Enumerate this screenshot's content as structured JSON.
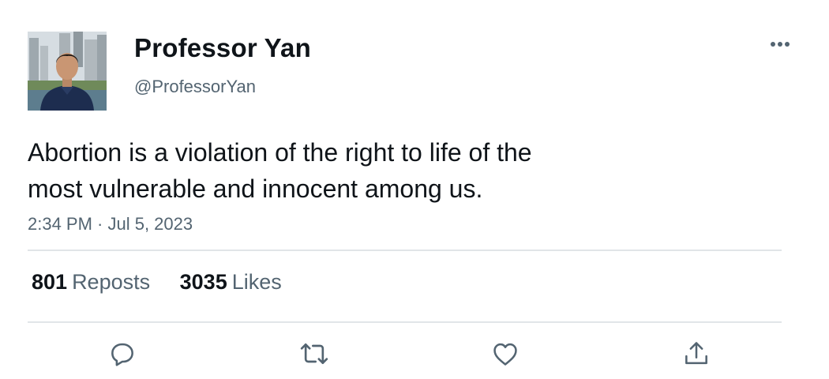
{
  "author": {
    "display_name": "Professor Yan",
    "handle": "@ProfessorYan",
    "avatar_icon": "profile-photo"
  },
  "tweet": {
    "text_line1": "Abortion is a violation of the right to life of the",
    "text_line2": "most vulnerable and innocent among us.",
    "timestamp": "2:34 PM · Jul 5, 2023"
  },
  "stats": {
    "reposts_count": "801",
    "reposts_label": "Reposts",
    "likes_count": "3035",
    "likes_label": "Likes"
  },
  "actions": {
    "reply_icon": "reply-icon",
    "repost_icon": "repost-icon",
    "like_icon": "heart-icon",
    "share_icon": "share-icon",
    "more_icon": "more-icon"
  },
  "colors": {
    "text_primary": "#0f1419",
    "text_secondary": "#536471",
    "divider": "#e1e5e8",
    "icon": "#536471"
  }
}
